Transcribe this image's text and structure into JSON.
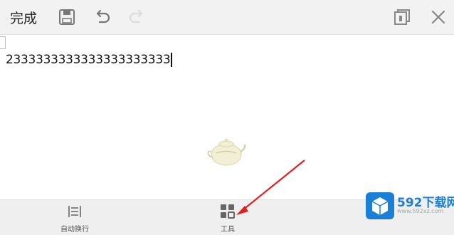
{
  "toolbar": {
    "done_label": "完成",
    "icons": [
      "save-icon",
      "undo-icon",
      "redo-icon",
      "copy-icon",
      "close-icon"
    ]
  },
  "editor": {
    "content": "2333333333333333333333"
  },
  "bottombar": {
    "wrap_label": "自动换行",
    "tools_label": "工具"
  },
  "watermark": {
    "title": "592下载网",
    "url": "www.592xz.com"
  },
  "colors": {
    "toolbar_bg": "#f2f2f2",
    "icon_gray": "#8a8a8a",
    "arrow_red": "#e02020",
    "brand_blue": "#1a7fd6"
  }
}
